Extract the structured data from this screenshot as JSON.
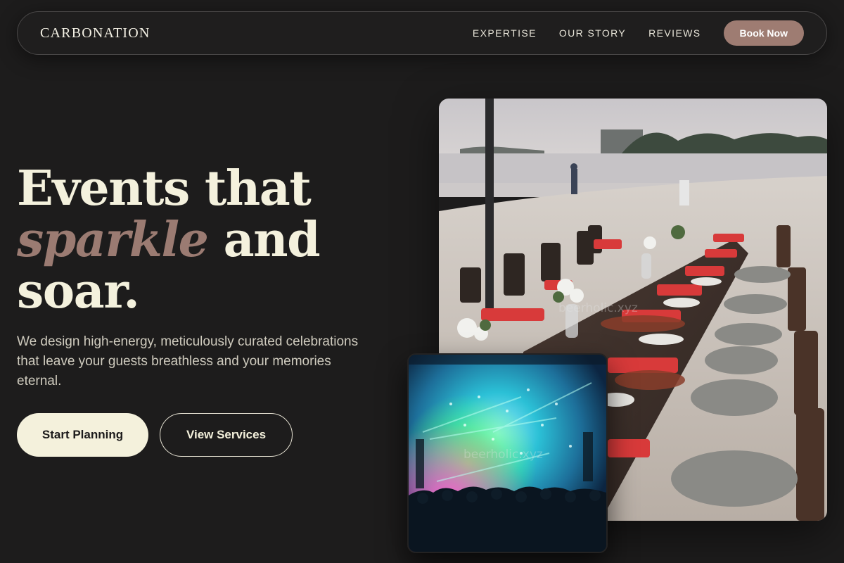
{
  "brand": {
    "name": "CARBONATION"
  },
  "nav": {
    "links": [
      {
        "label": "EXPERTISE"
      },
      {
        "label": "OUR STORY"
      },
      {
        "label": "REVIEWS"
      }
    ],
    "cta_label": "Book Now"
  },
  "hero": {
    "title_line1": "Events that",
    "title_accent": "sparkle",
    "title_line2_rest": " and",
    "title_line3": "soar.",
    "subtitle": "We design high-energy, meticulously curated celebrations that leave your guests breathless and your memories eternal.",
    "primary_cta": "Start Planning",
    "secondary_cta": "View Services"
  },
  "images": {
    "main_watermark": "beerholic.xyz",
    "concert_watermark": "beerholic.xyz"
  },
  "colors": {
    "background": "#1d1c1c",
    "cream": "#f4f1dc",
    "accent_mauve": "#9e7c72"
  }
}
